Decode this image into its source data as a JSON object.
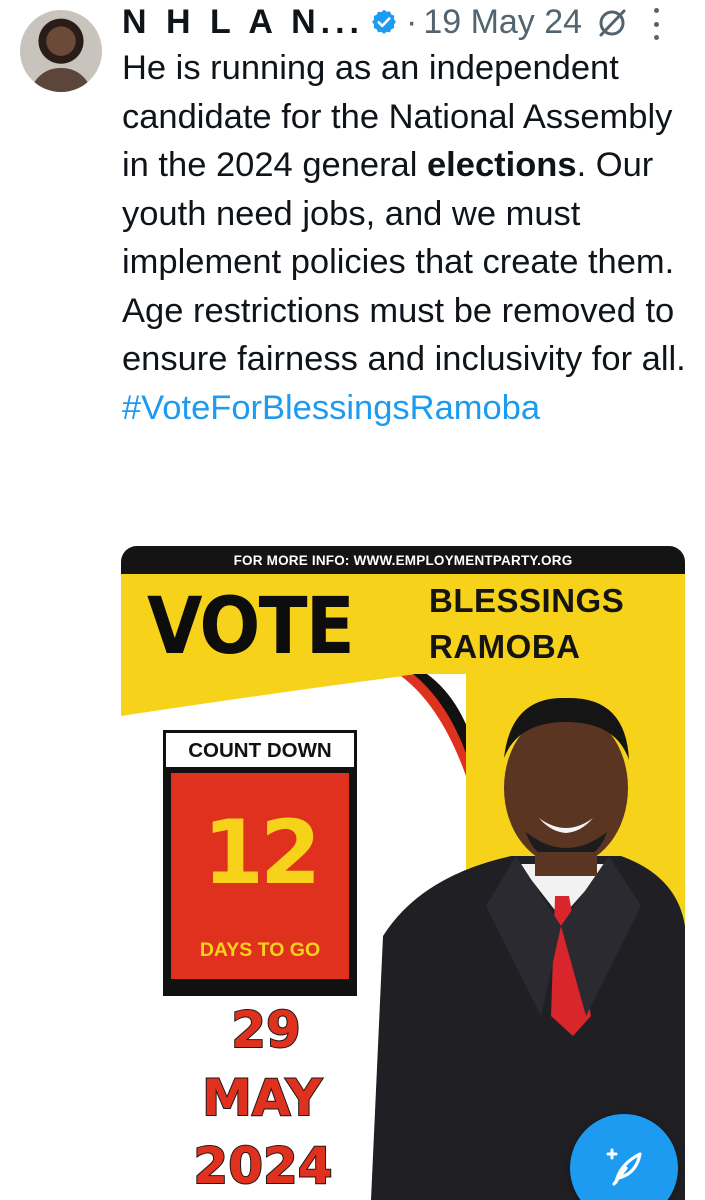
{
  "tweet": {
    "author_name": "N H L A N...",
    "verified_icon": "verified-badge-icon",
    "separator": "·",
    "date": "19 May 24",
    "text_before_bold": "He is running as an independent candidate for the National Assembly in the 2024 general ",
    "text_bold": "elections",
    "text_after_bold": ". Our youth need jobs, and we must implement policies that create them. Age restrictions must be removed to ensure fairness and inclusivity for all.",
    "hashtag": "#VoteForBlessingsRamoba",
    "colors": {
      "text": "#0f1419",
      "secondary": "#536471",
      "link": "#1d9bf0"
    }
  },
  "poster": {
    "info_bar": "FOR MORE INFO: WWW.EMPLOYMENTPARTY.ORG",
    "vote_word": "VOTE",
    "candidate_first": "BLESSINGS",
    "candidate_last": "RAMOBA",
    "count_label": "COUNT DOWN",
    "count_number": "12",
    "days_label": "DAYS TO GO",
    "date_day": "29",
    "date_month": "MAY",
    "date_year": "2024",
    "colors": {
      "yellow": "#f7d21b",
      "red": "#e0301e",
      "black": "#111111"
    }
  },
  "compose_button": {
    "icon": "compose-post-icon"
  }
}
